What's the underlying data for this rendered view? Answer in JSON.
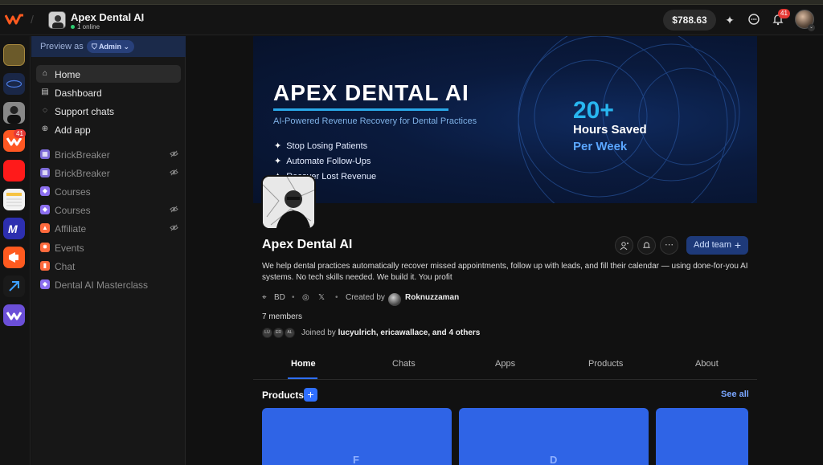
{
  "topbar": {
    "workspace_name": "Apex Dental AI",
    "online_status": "1 online",
    "balance": "$788.63",
    "notification_count": "41"
  },
  "rail": {
    "apps": [
      {
        "name": "rail-app-lisu-vault",
        "color": "#6b5a2a"
      },
      {
        "name": "rail-app-blue-brand",
        "color": "#1a2747"
      },
      {
        "name": "rail-app-profile",
        "color": "#888888"
      },
      {
        "name": "rail-app-whop",
        "color": "#ff5722"
      },
      {
        "name": "rail-app-youtube",
        "color": "#ff1a1a"
      },
      {
        "name": "rail-app-spreadsheet",
        "color": "#f2f2f2"
      },
      {
        "name": "rail-app-m-brand",
        "color": "#2d2fb0"
      },
      {
        "name": "rail-app-megaphone",
        "color": "#ff5a1f"
      },
      {
        "name": "rail-app-arrow",
        "color": "#1a1a1a"
      },
      {
        "name": "rail-app-whop-purple",
        "color": "#6b4fd8"
      }
    ],
    "badge": "41"
  },
  "sidebar": {
    "preview_label": "Preview as",
    "role": "Admin",
    "items": [
      {
        "label": "Home",
        "icon": "home-icon",
        "active": true,
        "hidden": false
      },
      {
        "label": "Dashboard",
        "icon": "chart-icon",
        "active": false,
        "hidden": false
      },
      {
        "label": "Support chats",
        "icon": "chat-bubble-icon",
        "active": false,
        "hidden": false
      },
      {
        "label": "Add app",
        "icon": "plus-circle-icon",
        "active": false,
        "hidden": false
      },
      {
        "label": "BrickBreaker",
        "icon": "game-icon",
        "active": false,
        "hidden": true
      },
      {
        "label": "BrickBreaker",
        "icon": "game-icon",
        "active": false,
        "hidden": true
      },
      {
        "label": "Courses",
        "icon": "graduation-cap-icon",
        "active": false,
        "hidden": false
      },
      {
        "label": "Courses",
        "icon": "graduation-cap-icon",
        "active": false,
        "hidden": true
      },
      {
        "label": "Affiliate",
        "icon": "affiliate-icon",
        "active": false,
        "hidden": true
      },
      {
        "label": "Events",
        "icon": "calendar-icon",
        "active": false,
        "hidden": false
      },
      {
        "label": "Chat",
        "icon": "chat-icon",
        "active": false,
        "hidden": false
      },
      {
        "label": "Dental AI Masterclass",
        "icon": "graduation-cap-icon",
        "active": false,
        "hidden": false
      }
    ]
  },
  "banner": {
    "title": "APEX DENTAL AI",
    "subtitle": "AI-Powered Revenue Recovery for Dental Practices",
    "bullets": [
      "Stop Losing Patients",
      "Automate Follow-Ups",
      "Recover Lost Revenue"
    ],
    "big_number": "20+",
    "line1": "Hours Saved",
    "line2": "Per Week"
  },
  "profile": {
    "name": "Apex Dental AI",
    "add_team_label": "Add team",
    "description": "We help dental practices automatically recover missed appointments, follow up with leads, and fill their calendar — using done-for-you AI systems. No tech skills needed. We build it. You profit",
    "location": "BD",
    "created_by_label": "Created by",
    "creator": "Roknuzzaman",
    "members": "7 members",
    "member_initials": [
      "LU",
      "ER",
      "AL"
    ],
    "joined_prefix": "Joined by",
    "joined_names": "lucyulrich, ericawallace,",
    "joined_suffix": "and 4 others"
  },
  "tabs": [
    "Home",
    "Chats",
    "Apps",
    "Products",
    "About"
  ],
  "products": {
    "heading": "Products",
    "see_all": "See all",
    "cards": [
      {
        "letter": "F"
      },
      {
        "letter": "D"
      },
      {
        "letter": ""
      }
    ]
  }
}
